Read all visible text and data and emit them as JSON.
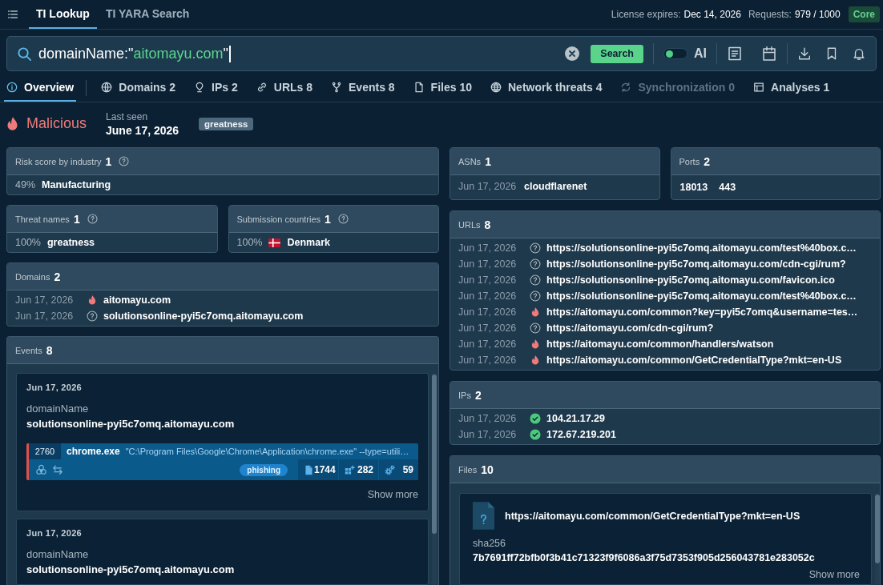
{
  "top_bar": {
    "nav_tabs": [
      {
        "label": "TI Lookup",
        "selected": true
      },
      {
        "label": "TI YARA Search",
        "selected": false
      }
    ],
    "license": {
      "label": "License expires:",
      "value": "Dec 14, 2026"
    },
    "requests": {
      "label": "Requests:",
      "value": "979 / 1000"
    },
    "plan_badge": "Core"
  },
  "search": {
    "query": [
      {
        "kind": "plain",
        "text": "domainName:\""
      },
      {
        "kind": "value",
        "text": "aitomayu.com"
      },
      {
        "kind": "plain",
        "text": "\""
      }
    ],
    "button": "Search",
    "ai_toggle": {
      "label": "AI",
      "on": false
    }
  },
  "tabs": [
    {
      "label": "Overview",
      "selected": true,
      "disabled": false
    },
    {
      "label": "Domains 2",
      "selected": false,
      "disabled": false
    },
    {
      "label": "IPs 2",
      "selected": false,
      "disabled": false
    },
    {
      "label": "URLs 8",
      "selected": false,
      "disabled": false
    },
    {
      "label": "Events 8",
      "selected": false,
      "disabled": false
    },
    {
      "label": "Files 10",
      "selected": false,
      "disabled": false
    },
    {
      "label": "Network threats 4",
      "selected": false,
      "disabled": false
    },
    {
      "label": "Synchronization 0",
      "selected": false,
      "disabled": true
    },
    {
      "label": "Analyses 1",
      "selected": false,
      "disabled": false
    }
  ],
  "summary": {
    "verdict": {
      "kind": "malicious",
      "label": "Malicious"
    },
    "last_seen": {
      "label": "Last seen",
      "value": "June 17, 2026"
    },
    "tags": [
      "greatness"
    ]
  },
  "risk_score": {
    "title": "Risk score by industry",
    "count": "1",
    "help": true,
    "rows": [
      {
        "share": "49%",
        "name": "Manufacturing"
      }
    ]
  },
  "threat_names": {
    "title": "Threat names",
    "count": "1",
    "help": true,
    "rows": [
      {
        "share": "100%",
        "name": "greatness"
      }
    ]
  },
  "submission_countries": {
    "title": "Submission countries",
    "count": "1",
    "help": true,
    "rows": [
      {
        "share": "100%",
        "name": "Denmark"
      }
    ]
  },
  "domains": {
    "title": "Domains",
    "count": "2",
    "rows": [
      {
        "date": "Jun 17, 2026",
        "kind": "malicious",
        "value": "aitomayu.com"
      },
      {
        "date": "Jun 17, 2026",
        "kind": "unknown",
        "value": "solutionsonline-pyi5c7omq.aitomayu.com"
      }
    ]
  },
  "events": {
    "title": "Events",
    "count": "8",
    "items": [
      {
        "date": "Jun 17, 2026",
        "field_label": "domainName",
        "field_value": "solutionsonline-pyi5c7omq.aitomayu.com",
        "process": {
          "pid": "2760",
          "name": "chrome.exe",
          "command": "\"C:\\Program Files\\Google\\Chrome\\Application\\chrome.exe\" --type=utili…",
          "tag": "phishing",
          "stats": [
            "1744",
            "282",
            "59"
          ]
        },
        "show_more": "Show more"
      },
      {
        "date": "Jun 17, 2026",
        "field_label": "domainName",
        "field_value": "solutionsonline-pyi5c7omq.aitomayu.com"
      }
    ]
  },
  "asns": {
    "title": "ASNs",
    "count": "1",
    "rows": [
      {
        "date": "Jun 17, 2026",
        "name": "cloudflarenet"
      }
    ]
  },
  "ports": {
    "title": "Ports",
    "count": "2",
    "values": [
      "18013",
      "443"
    ]
  },
  "urls": {
    "title": "URLs",
    "count": "8",
    "rows": [
      {
        "date": "Jun 17, 2026",
        "kind": "unknown",
        "value": "https://solutionsonline-pyi5c7omq.aitomayu.com/test%40box.c…"
      },
      {
        "date": "Jun 17, 2026",
        "kind": "unknown",
        "value": "https://solutionsonline-pyi5c7omq.aitomayu.com/cdn-cgi/rum?"
      },
      {
        "date": "Jun 17, 2026",
        "kind": "unknown",
        "value": "https://solutionsonline-pyi5c7omq.aitomayu.com/favicon.ico"
      },
      {
        "date": "Jun 17, 2026",
        "kind": "unknown",
        "value": "https://solutionsonline-pyi5c7omq.aitomayu.com/test%40box.c…"
      },
      {
        "date": "Jun 17, 2026",
        "kind": "malicious",
        "value": "https://aitomayu.com/common?key=pyi5c7omq&username=tes…"
      },
      {
        "date": "Jun 17, 2026",
        "kind": "unknown",
        "value": "https://aitomayu.com/cdn-cgi/rum?"
      },
      {
        "date": "Jun 17, 2026",
        "kind": "malicious",
        "value": "https://aitomayu.com/common/handlers/watson"
      },
      {
        "date": "Jun 17, 2026",
        "kind": "malicious",
        "value": "https://aitomayu.com/common/GetCredentialType?mkt=en-US"
      }
    ]
  },
  "ips": {
    "title": "IPs",
    "count": "2",
    "rows": [
      {
        "date": "Jun 17, 2026",
        "kind": "clean",
        "value": "104.21.17.29"
      },
      {
        "date": "Jun 17, 2026",
        "kind": "clean",
        "value": "172.67.219.201"
      }
    ]
  },
  "files": {
    "title": "Files",
    "count": "10",
    "items": [
      {
        "name": "https://aitomayu.com/common/GetCredentialType?mkt=en-US",
        "hash_label": "sha256",
        "hash": "7b7691ff72bfb0f3b41c71323f9f6086a3f75d7353f905d256043781e283052c",
        "show_more": "Show more"
      }
    ]
  }
}
